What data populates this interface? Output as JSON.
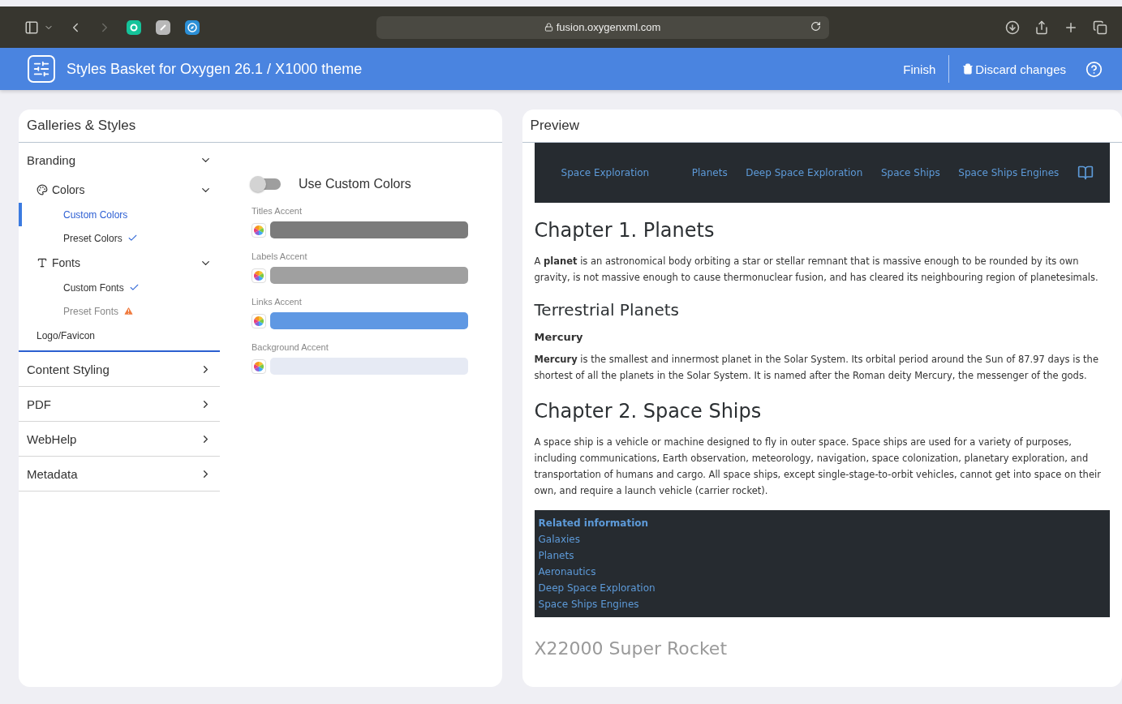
{
  "browser": {
    "url": "fusion.oxygenxml.com"
  },
  "header": {
    "title": "Styles Basket for Oxygen 26.1 / X1000 theme",
    "actions": [
      {
        "label": "Finish",
        "kind": "text"
      },
      {
        "label": "Discard changes",
        "kind": "trash"
      }
    ]
  },
  "sidebar": {
    "title": "Galleries & Styles",
    "sections": [
      {
        "label": "Branding",
        "expanded": true,
        "children": [
          {
            "label": "Colors",
            "kind": "palette",
            "expanded": true,
            "children": [
              {
                "label": "Custom Colors",
                "selected": true,
                "kind": "plain"
              },
              {
                "label": "Preset Colors",
                "selected": false,
                "kind": "check"
              }
            ]
          },
          {
            "label": "Fonts",
            "kind": "font",
            "expanded": true,
            "children": [
              {
                "label": "Custom Fonts",
                "selected": false,
                "kind": "check"
              },
              {
                "label": "Preset Fonts",
                "selected": false,
                "kind": "warning"
              }
            ]
          },
          {
            "label": "Logo/Favicon",
            "kind": "plain"
          }
        ]
      },
      {
        "label": "Content Styling",
        "expanded": false
      },
      {
        "label": "PDF",
        "expanded": false
      },
      {
        "label": "WebHelp",
        "expanded": false
      },
      {
        "label": "Metadata",
        "expanded": false
      }
    ]
  },
  "custom_colors": {
    "toggle": {
      "label": "Use Custom Colors",
      "on": false
    },
    "accents": [
      {
        "label": "Titles Accent",
        "color": "#7b7b7b"
      },
      {
        "label": "Labels Accent",
        "color": "#a0a0a0"
      },
      {
        "label": "Links Accent",
        "color": "#5f98e3"
      },
      {
        "label": "Background Accent",
        "color": "#e6eaf4"
      }
    ]
  },
  "preview": {
    "title": "Preview",
    "nav": [
      "Space Exploration",
      "Planets",
      "Deep Space Exploration",
      "Space Ships",
      "Space Ships Engines"
    ],
    "blocks": [
      {
        "kind": "h1",
        "text": "Chapter 1. Planets"
      },
      {
        "kind": "p",
        "text": "A **planet** is an astronomical body orbiting a star or stellar remnant that is massive enough to be rounded by its own gravity, is not massive enough to cause thermonuclear fusion, and has cleared its neighbouring region of planetesimals."
      },
      {
        "kind": "h2",
        "text": "Terrestrial Planets"
      },
      {
        "kind": "h3",
        "text": "Mercury"
      },
      {
        "kind": "p",
        "text": "**Mercury** is the smallest and innermost planet in the Solar System. Its orbital period around the Sun of 87.97 days is the shortest of all the planets in the Solar System. It is named after the Roman deity Mercury, the messenger of the gods."
      },
      {
        "kind": "h1",
        "text": "Chapter 2. Space Ships"
      },
      {
        "kind": "p",
        "text": "A space ship is a vehicle or machine designed to fly in outer space. Space ships are used for a variety of purposes, including communications, Earth observation, meteorology, navigation, space colonization, planetary exploration, and transportation of humans and cargo. All space ships, except single-stage-to-orbit vehicles, cannot get into space on their own, and require a launch vehicle (carrier rocket)."
      }
    ],
    "related": {
      "title": "Related information",
      "links": [
        "Galaxies",
        "Planets",
        "Aeronautics",
        "Deep Space Exploration",
        "Space Ships Engines"
      ]
    },
    "next_heading": "X22000 Super Rocket"
  }
}
